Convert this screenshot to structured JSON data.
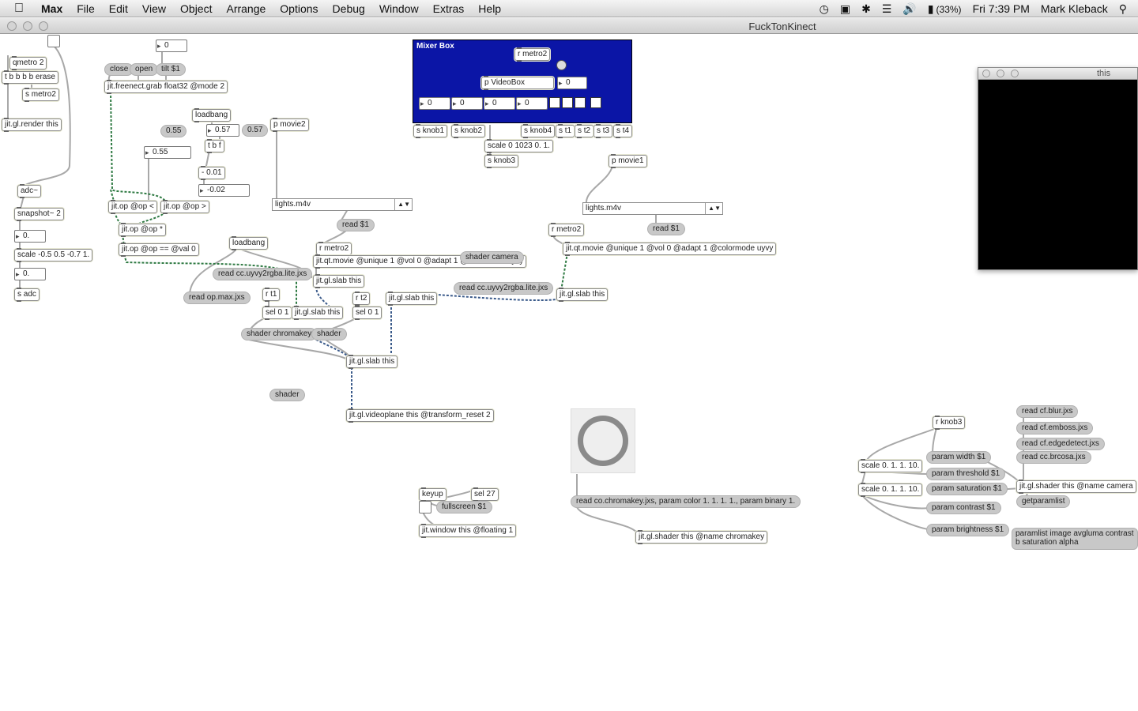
{
  "menubar": {
    "app_name": "Max",
    "items": [
      "File",
      "Edit",
      "View",
      "Object",
      "Arrange",
      "Options",
      "Debug",
      "Window",
      "Extras",
      "Help"
    ],
    "battery": "(33%)",
    "clock": "Fri 7:39 PM",
    "user": "Mark Kleback"
  },
  "window": {
    "title": "FuckTonKinect"
  },
  "floating_window": {
    "title": "this"
  },
  "mixer": {
    "title": "Mixer Box",
    "r_metro2": "r metro2",
    "p_videobox": "p VideoBox",
    "vb_num": "0",
    "nums": [
      "0",
      "0",
      "0",
      "0"
    ]
  },
  "objects": {
    "qmetro": "qmetro 2",
    "tbbb": "t b b b b erase",
    "s_metro2": "s metro2",
    "render": "jit.gl.render this",
    "adc": "adc~",
    "snapshot": "snapshot~ 2",
    "scale_adc": "scale -0.5 0.5 -0.7 1.",
    "s_adc": "s adc",
    "freenect": "jit.freenect.grab float32 @mode 2",
    "loadbang1": "loadbang",
    "tbf": "t b f",
    "minus": "- 0.01",
    "op_lt": "jit.op @op <",
    "op_gt": "jit.op @op >",
    "op_mul": "jit.op @op *",
    "op_eq": "jit.op @op == @val 0",
    "loadbang2": "loadbang",
    "p_movie2": "p movie2",
    "r_metro2_a": "r metro2",
    "qtmovie_a": "jit.qt.movie @unique 1 @vol 0 @adapt 1 @colormode uyvy",
    "slab_a": "jit.gl.slab this",
    "r_t1": "r t1",
    "r_t2": "r t2",
    "sel1": "sel 0 1",
    "sel2": "sel 0 1",
    "slab_b": "jit.gl.slab this",
    "slab_c": "jit.gl.slab this",
    "slab_d": "jit.gl.slab this",
    "slab_main": "jit.gl.slab this",
    "videoplane": "jit.gl.videoplane this @transform_reset 2",
    "s_knob1": "s knob1",
    "s_knob2": "s knob2",
    "s_knob4": "s knob4",
    "s_t1": "s t1",
    "s_t2": "s t2",
    "s_t3": "s t3",
    "s_t4": "s t4",
    "scale_knob": "scale 0 1023 0. 1.",
    "s_knob3": "s knob3",
    "p_movie1": "p movie1",
    "r_metro2_b": "r metro2",
    "qtmovie_b": "jit.qt.movie @unique 1 @vol 0 @adapt 1 @colormode uyvy",
    "keyup": "keyup",
    "sel27": "sel 27",
    "jitwindow": "jit.window this @floating 1",
    "shader_chroma": "jit.gl.shader this @name chromakey",
    "r_knob3": "r knob3",
    "scale_a": "scale 0. 1. 1. 10.",
    "scale_b": "scale 0. 1. 1. 10.",
    "shader_camera": "jit.gl.shader this @name camera"
  },
  "messages": {
    "close": "close",
    "open": "open",
    "tilt": "tilt $1",
    "m055": "0.55",
    "m057": "0.57",
    "read_cc": "read cc.uyvy2rgba.lite.jxs",
    "read_op": "read op.max.jxs",
    "shader_chromakey": "shader chromakey",
    "shader1": "shader",
    "shader2": "shader",
    "shader_camera": "shader camera",
    "read_cc2": "read cc.uyvy2rgba.lite.jxs",
    "read1": "read $1",
    "read2": "read $1",
    "fullscreen": "fullscreen $1",
    "read_chroma": "read co.chromakey.jxs, param color 1. 1. 1. 1., param binary 1.",
    "param_width": "param width $1",
    "param_threshold": "param threshold $1",
    "param_saturation": "param saturation $1",
    "param_contrast": "param contrast $1",
    "param_brightness": "param brightness $1",
    "read_blur": "read cf.blur.jxs",
    "read_emboss": "read cf.emboss.jxs",
    "read_edge": "read cf.edgedetect.jxs",
    "read_brcosa": "read cc.brcosa.jxs",
    "getparamlist": "getparamlist",
    "paramlist": "paramlist image avgluma contrast b saturation alpha"
  },
  "numbers": {
    "tilt_num": "0",
    "n057": "0.57",
    "n055": "0.55",
    "nneg": "-0.02",
    "adc_num1": "0.",
    "adc_num2": "0."
  },
  "menus": {
    "movie_a": "lights.m4v",
    "movie_b": "lights.m4v"
  }
}
